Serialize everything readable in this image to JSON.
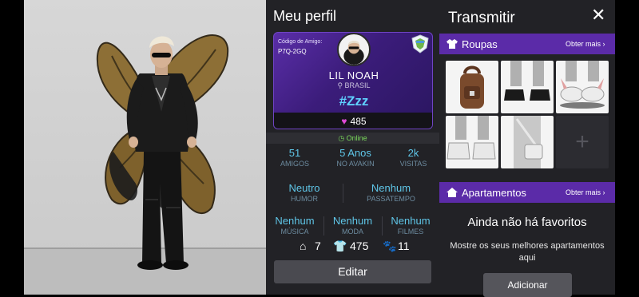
{
  "profile": {
    "title": "Meu perfil",
    "friend_code_label": "Código de Amigo:",
    "friend_code": "P7Q-2GQ",
    "name": "LIL NOAH",
    "country": "BRASIL",
    "status": "#Zzz",
    "hearts": "485",
    "online": "Online",
    "stats": [
      {
        "value": "51",
        "label": "AMIGOS"
      },
      {
        "value": "5 Anos",
        "label": "NO AVAKIN"
      },
      {
        "value": "2k",
        "label": "VISITAS"
      }
    ],
    "mood": {
      "value": "Neutro",
      "label": "HUMOR"
    },
    "hobby": {
      "value": "Nenhum",
      "label": "PASSATEMPO"
    },
    "music": {
      "value": "Nenhum",
      "label": "MÚSICA"
    },
    "fashion": {
      "value": "Nenhum",
      "label": "MODA"
    },
    "movies": {
      "value": "Nenhum",
      "label": "FILMES"
    },
    "counts": {
      "apartments": "7",
      "clothes": "475",
      "pets": "11"
    },
    "edit_label": "Editar"
  },
  "broadcast": {
    "title": "Transmitir",
    "clothes_section": {
      "label": "Roupas",
      "more": "Obter mais ›"
    },
    "apartments_section": {
      "label": "Apartamentos",
      "more": "Obter mais ›"
    },
    "clothing_items": [
      "backpack",
      "black-sneakers",
      "bunny-slippers",
      "white-sneakers",
      "crossbody-bag"
    ],
    "add_tile_symbol": "+",
    "no_favorites_title": "Ainda não há favoritos",
    "no_favorites_sub": "Mostre os seus melhores apartamentos aqui",
    "add_label": "Adicionar"
  },
  "colors": {
    "accent": "#5b2ba8",
    "stat_value": "#5fc6e8",
    "online": "#7cdc5c",
    "status": "#5fd0ff"
  }
}
